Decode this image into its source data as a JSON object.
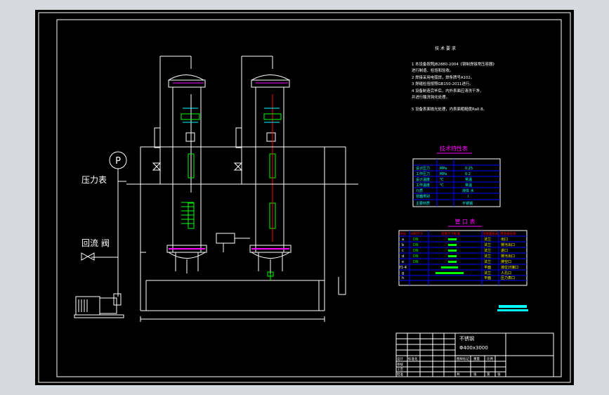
{
  "labels": {
    "pressure_gauge": "压力表",
    "gauge_symbol": "P",
    "return_valve": "回流 阀"
  },
  "tech_requirements": {
    "title": "技 术 要 求",
    "lines": [
      "1  本设备按照JB2880-2004《钢制焊接常压容器》",
      "   进行制造、检验和验收。",
      "2  焊接采用电弧焊，焊条牌号A102。",
      "3  焊缝检验按照GB150-2011进行。",
      "4  设备制造完毕后，内外表面应清洗干净，",
      "   并进行酸洗钝化处理。",
      "5  设备表面抛光处理，内表面粗糙度Ra0.8。"
    ]
  },
  "spec_table": {
    "title": "技术特性表",
    "rows": [
      [
        "设计压力",
        "MPa",
        "0.25"
      ],
      [
        "工作压力",
        "MPa",
        "0.2"
      ],
      [
        "设计温度",
        "℃",
        "常温"
      ],
      [
        "工作温度",
        "℃",
        "常温"
      ],
      [
        "介质",
        "",
        "液体 水"
      ],
      [
        "容器类别",
        "",
        "I"
      ],
      [
        "主要材质",
        "",
        "不锈钢"
      ]
    ]
  },
  "nozzle_table": {
    "title": "管 口 表",
    "headers": [
      "符号",
      "公称尺寸",
      "连接尺寸标准",
      "连接面形式",
      "用途或名称"
    ],
    "rows": [
      [
        "a",
        "DN",
        "",
        "法兰",
        "出口"
      ],
      [
        "b",
        "DN",
        "",
        "法兰",
        "排污出口"
      ],
      [
        "c",
        "DN",
        "",
        "法兰",
        "进口"
      ],
      [
        "d",
        "DN",
        "",
        "法兰",
        "排污出口"
      ],
      [
        "e",
        "DN",
        "",
        "法兰",
        "排空口"
      ],
      [
        "f1-4",
        "",
        "",
        "平面",
        "液位计接口"
      ],
      [
        "g",
        "",
        "",
        "法兰",
        "人孔口"
      ],
      [
        "h",
        "",
        "",
        "平面",
        "压力表口"
      ]
    ]
  },
  "title_block": {
    "name": "不锈钢",
    "spec": "Φ400x3000",
    "rows": [
      "设计",
      "审核",
      "工艺",
      "标准化",
      "批准"
    ],
    "small": [
      "图样标记",
      "重量",
      "比例",
      "共",
      "张",
      "第",
      "张"
    ]
  },
  "colors": {
    "line": "#ffffff",
    "accent_magenta": "#ff00ff",
    "accent_green": "#00ff00",
    "accent_blue": "#0000ff",
    "accent_cyan": "#00ffff",
    "accent_red": "#ff0000",
    "accent_yellow": "#ffff00"
  }
}
